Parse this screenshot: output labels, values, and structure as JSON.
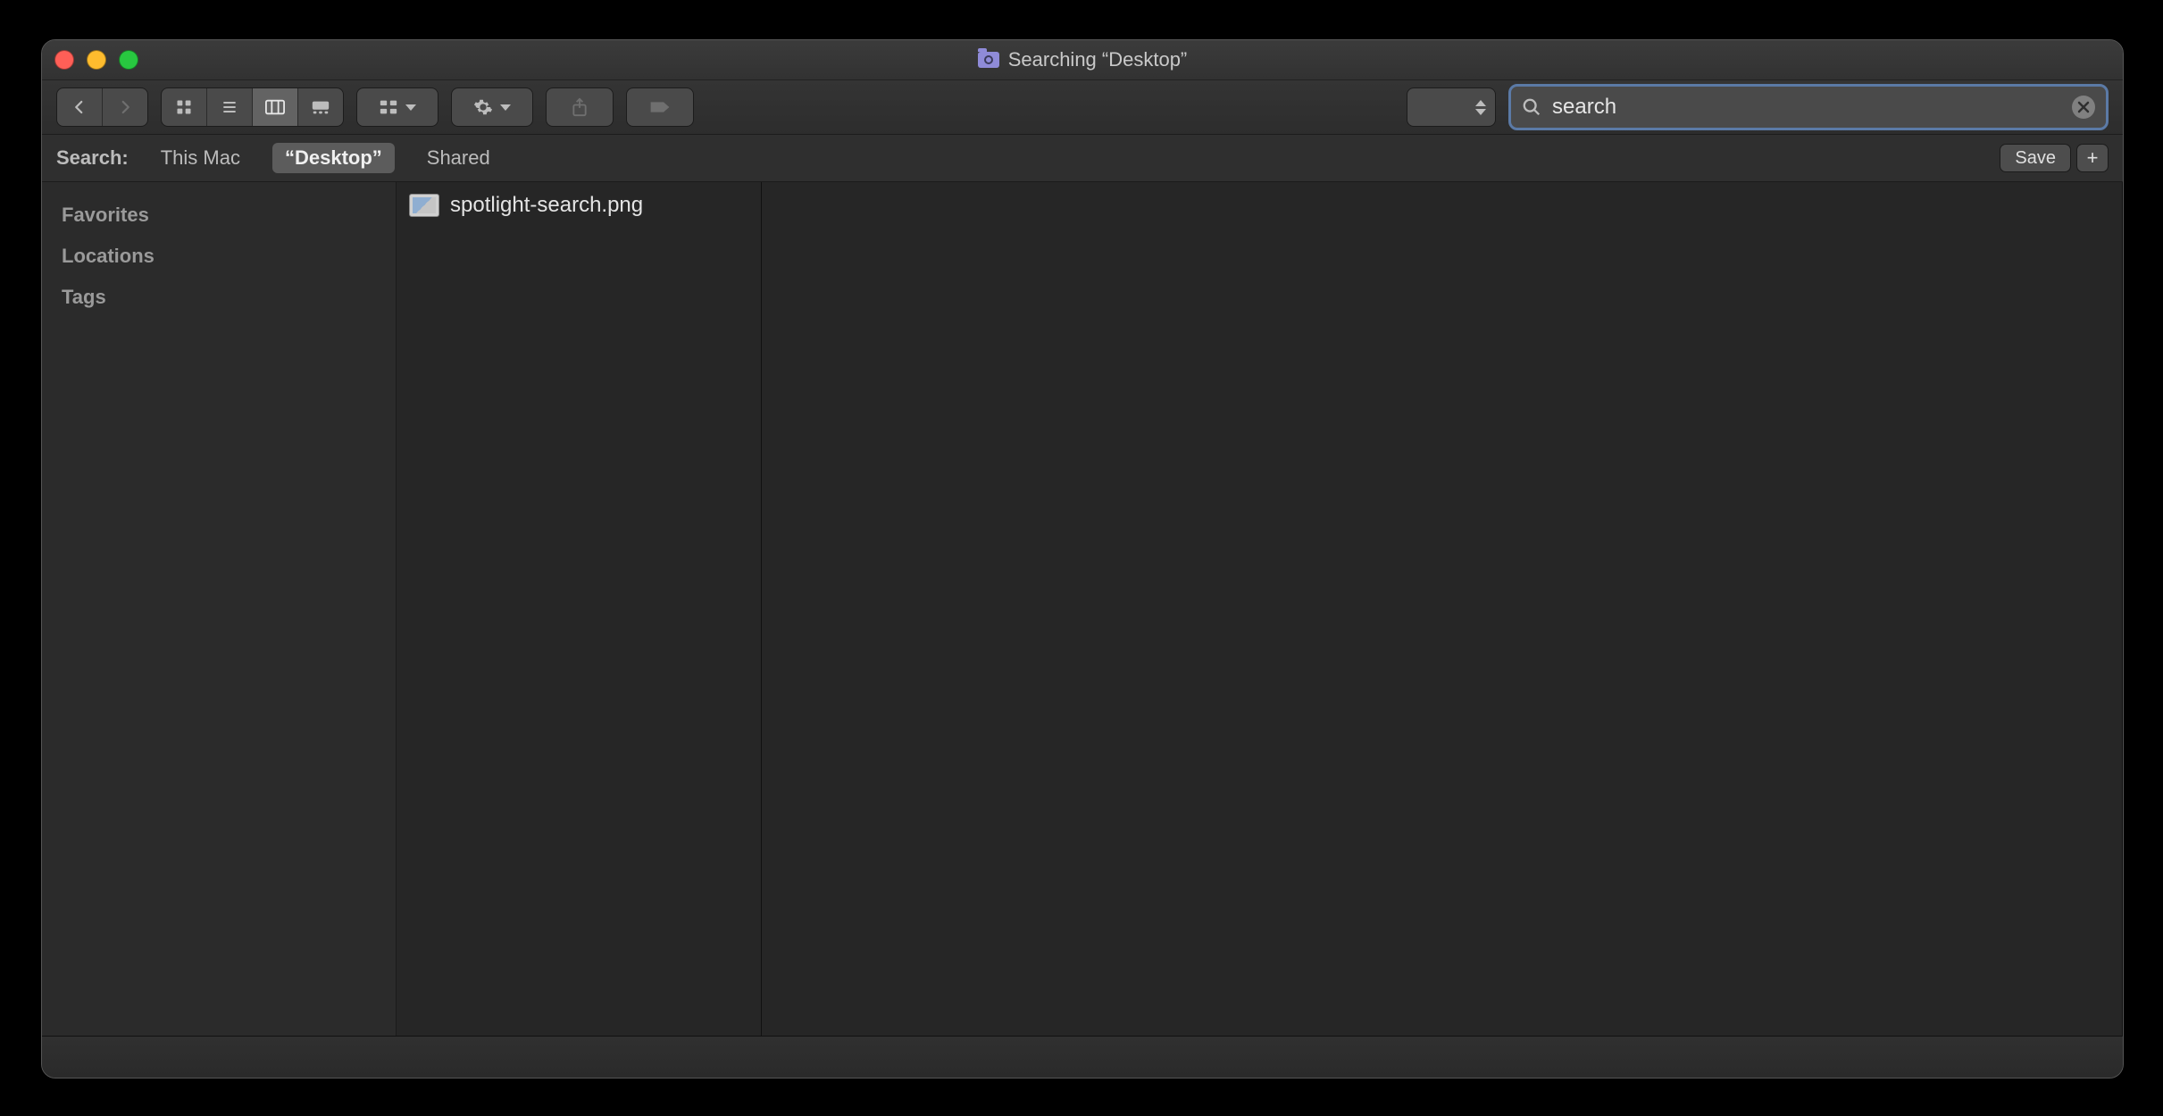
{
  "window": {
    "title": "Searching “Desktop”"
  },
  "sidebar": {
    "sections": [
      "Favorites",
      "Locations",
      "Tags"
    ]
  },
  "scope": {
    "label": "Search:",
    "options": [
      "This Mac",
      "“Desktop”",
      "Shared"
    ],
    "active_index": 1,
    "save_label": "Save",
    "plus_label": "+"
  },
  "search": {
    "value": "search",
    "placeholder": "Search"
  },
  "results": {
    "col1": [
      {
        "name": "spotlight-search.png"
      }
    ]
  }
}
